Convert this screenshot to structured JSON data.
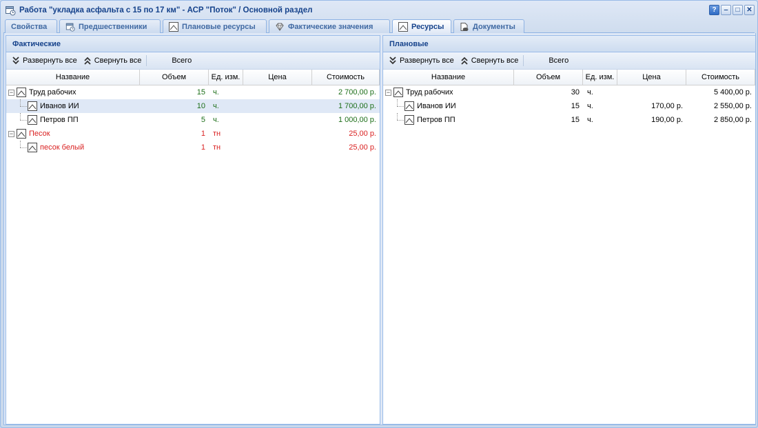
{
  "window": {
    "title": "Работа \"укладка асфальта с 15 по 17 км\" - АСР \"Поток\" / Основной раздел",
    "tools": {
      "help": "?",
      "minimize": "‒",
      "maximize": "□",
      "close": "✕"
    }
  },
  "tabs": [
    {
      "label": "Свойства",
      "icon": "none",
      "active": false
    },
    {
      "label": "Предшественники",
      "icon": "clock-calendar-icon",
      "active": false
    },
    {
      "label": "Плановые ресурсы",
      "icon": "resource-icon",
      "active": false
    },
    {
      "label": "Фактические значения",
      "icon": "diamond-icon",
      "active": false
    },
    {
      "label": "Ресурсы",
      "icon": "resource-icon",
      "active": true
    },
    {
      "label": "Документы",
      "icon": "documents-icon",
      "active": false
    }
  ],
  "left_panel": {
    "title": "Фактические",
    "toolbar": {
      "expand_all": "Развернуть все",
      "collapse_all": "Свернуть все",
      "total": "Всего"
    },
    "columns": {
      "name": "Название",
      "volume": "Объем",
      "unit": "Ед. изм.",
      "price": "Цена",
      "cost": "Стоимость"
    },
    "rows": [
      {
        "level": 0,
        "expander": "−",
        "name": "Труд рабочих",
        "volume": "15",
        "unit": "ч.",
        "price": "",
        "cost": "2 700,00 р.",
        "color": "green",
        "selected": false
      },
      {
        "level": 1,
        "expander": "",
        "name": "Иванов ИИ",
        "volume": "10",
        "unit": "ч.",
        "price": "",
        "cost": "1 700,00 р.",
        "color": "green",
        "selected": true
      },
      {
        "level": 1,
        "expander": "",
        "name": "Петров ПП",
        "volume": "5",
        "unit": "ч.",
        "price": "",
        "cost": "1 000,00 р.",
        "color": "green",
        "selected": false
      },
      {
        "level": 0,
        "expander": "−",
        "name": "Песок",
        "volume": "1",
        "unit": "тн",
        "price": "",
        "cost": "25,00 р.",
        "color": "red",
        "selected": false
      },
      {
        "level": 1,
        "expander": "",
        "name": "песок белый",
        "volume": "1",
        "unit": "тн",
        "price": "",
        "cost": "25,00 р.",
        "color": "red",
        "selected": false
      }
    ]
  },
  "right_panel": {
    "title": "Плановые",
    "toolbar": {
      "expand_all": "Развернуть все",
      "collapse_all": "Свернуть все",
      "total": "Всего"
    },
    "columns": {
      "name": "Название",
      "volume": "Объем",
      "unit": "Ед. изм.",
      "price": "Цена",
      "cost": "Стоимость"
    },
    "rows": [
      {
        "level": 0,
        "expander": "−",
        "name": "Труд рабочих",
        "volume": "30",
        "unit": "ч.",
        "price": "",
        "cost": "5 400,00 р.",
        "color": "black",
        "selected": false
      },
      {
        "level": 1,
        "expander": "",
        "name": "Иванов ИИ",
        "volume": "15",
        "unit": "ч.",
        "price": "170,00 р.",
        "cost": "2 550,00 р.",
        "color": "black",
        "selected": false
      },
      {
        "level": 1,
        "expander": "",
        "name": "Петров ПП",
        "volume": "15",
        "unit": "ч.",
        "price": "190,00 р.",
        "cost": "2 850,00 р.",
        "color": "black",
        "selected": false
      }
    ]
  },
  "colors": {
    "accent": "#15428b",
    "actual_green": "#1c6e18",
    "overrun_red": "#d91f1f",
    "selection": "#dfe8f6"
  }
}
